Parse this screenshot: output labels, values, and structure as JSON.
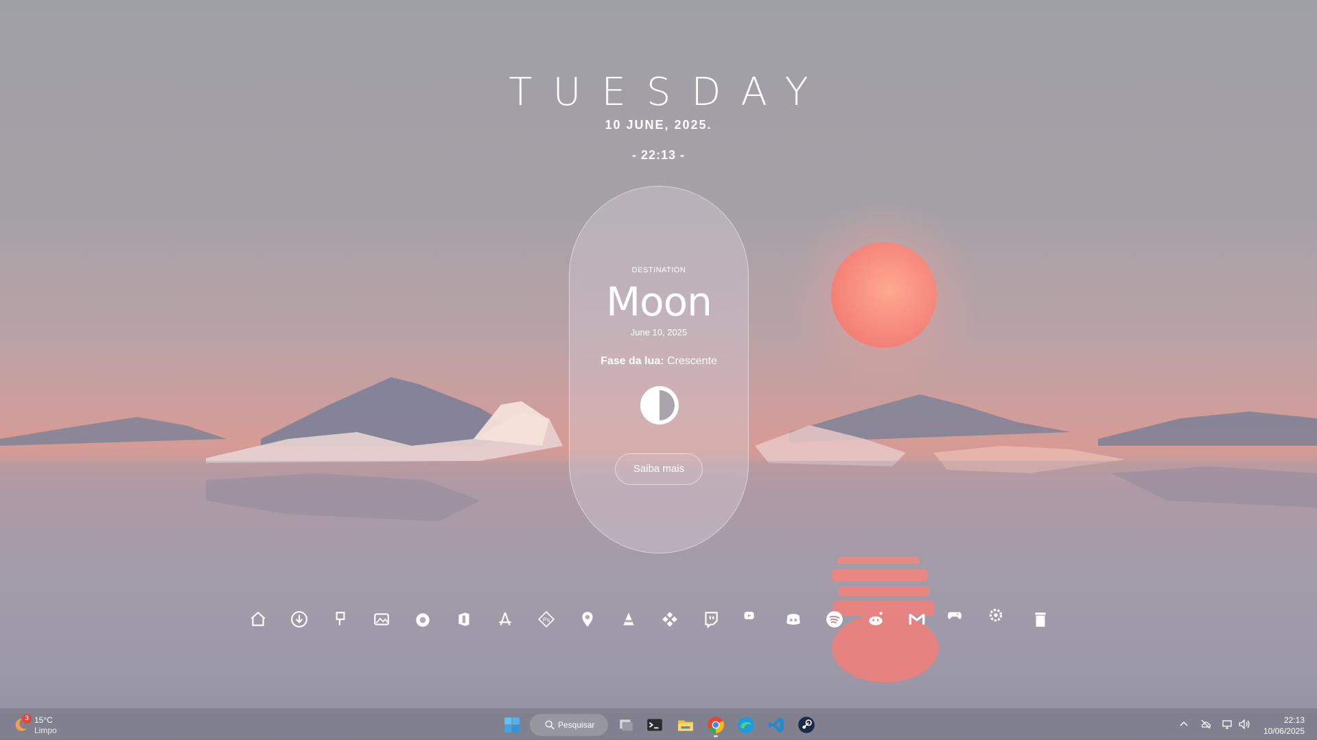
{
  "header": {
    "day": "TUESDAY",
    "date": "10 JUNE, 2025.",
    "time": "- 22:13 -"
  },
  "card": {
    "overline": "DESTINATION",
    "title": "Moon",
    "date": "June 10, 2025",
    "phase_label": "Fase da lua:",
    "phase_value": "Crescente",
    "button_label": "Saiba mais"
  },
  "dock": {
    "icons": [
      "home-icon",
      "download-icon",
      "paint-brush-icon",
      "photos-icon",
      "firefox-icon",
      "office-icon",
      "acrobat-icon",
      "photoshop-icon",
      "map-pin-icon",
      "vlc-icon",
      "kodi-icon",
      "twitch-icon",
      "youtube-icon",
      "discord-icon",
      "spotify-icon",
      "reddit-icon",
      "gmail-icon",
      "gamepad-icon",
      "settings-icon",
      "trash-icon"
    ]
  },
  "taskbar": {
    "weather": {
      "temp": "15°C",
      "condition": "Limpo",
      "badge": "3"
    },
    "search_label": "Pesquisar",
    "apps": [
      "windows-start",
      "search",
      "task-view",
      "terminal",
      "file-explorer",
      "chrome",
      "edge",
      "vscode",
      "steam"
    ],
    "clock_time": "22:13",
    "clock_date": "10/06/2025"
  },
  "colors": {
    "sun": "#f4877a",
    "taskbar": "#7a7a88",
    "accent": "#ffffff"
  }
}
